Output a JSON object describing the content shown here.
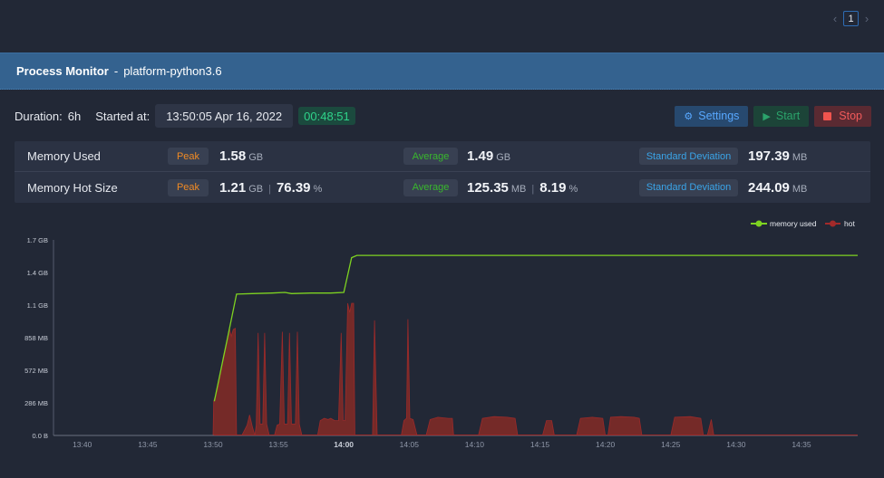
{
  "pagination": {
    "prev_icon": "chevron-left-icon",
    "current_page": "1",
    "next_icon": "chevron-right-icon"
  },
  "header": {
    "title": "Process Monitor",
    "separator": "-",
    "process": "platform-python3.6"
  },
  "toolbar": {
    "duration_label": "Duration:",
    "duration_value": "6h",
    "started_label": "Started at:",
    "started_value": "13:50:05 Apr 16, 2022",
    "elapsed": "00:48:51",
    "settings_label": "Settings",
    "start_label": "Start",
    "stop_label": "Stop"
  },
  "stats": {
    "rows": [
      {
        "name": "Memory Used",
        "peak_label": "Peak",
        "peak_value": "1.58",
        "peak_unit": "GB",
        "avg_label": "Average",
        "avg_value": "1.49",
        "avg_unit": "GB",
        "sd_label": "Standard Deviation",
        "sd_value": "197.39",
        "sd_unit": "MB"
      },
      {
        "name": "Memory Hot Size",
        "peak_label": "Peak",
        "peak_value": "1.21",
        "peak_unit": "GB",
        "peak_pct": "76.39",
        "pct_unit": "%",
        "avg_label": "Average",
        "avg_value": "125.35",
        "avg_unit": "MB",
        "avg_pct": "8.19",
        "sd_label": "Standard Deviation",
        "sd_value": "244.09",
        "sd_unit": "MB"
      }
    ]
  },
  "colors": {
    "memory_used": "#7ed321",
    "hot": "#8b2525",
    "hot_fill": "#7a2a28",
    "accent": "#34628f"
  },
  "chart_data": {
    "type": "area",
    "title": "",
    "xlabel": "",
    "ylabel": "",
    "x_unit": "minutes since 13:37",
    "x_ticks": [
      "13:40",
      "13:45",
      "13:50",
      "13:55",
      "14:00",
      "14:05",
      "14:10",
      "14:15",
      "14:20",
      "14:25",
      "14:30",
      "14:35"
    ],
    "x_tick_values": [
      3,
      8,
      13,
      18,
      23,
      28,
      33,
      38,
      43,
      48,
      53,
      58
    ],
    "bold_tick": "14:00",
    "xlim": [
      0.8,
      62.3
    ],
    "y_ticks": [
      "0.0 B",
      "286 MB",
      "572 MB",
      "858 MB",
      "1.1 GB",
      "1.4 GB",
      "1.7 GB"
    ],
    "y_tick_values_mb": [
      0,
      286,
      572,
      858,
      1144,
      1430,
      1716
    ],
    "ylim_mb": [
      0,
      1716
    ],
    "legend": [
      {
        "name": "memory used",
        "color": "#7ed321"
      },
      {
        "name": "hot",
        "color": "#a32a2a"
      }
    ],
    "legend_position": "top-right",
    "grid": false,
    "series": [
      {
        "name": "memory used",
        "type": "line",
        "points": [
          [
            13.1,
            300
          ],
          [
            14.1,
            850
          ],
          [
            14.8,
            1240
          ],
          [
            16.0,
            1245
          ],
          [
            17.5,
            1250
          ],
          [
            18.5,
            1255
          ],
          [
            19.0,
            1245
          ],
          [
            20.5,
            1250
          ],
          [
            22.0,
            1250
          ],
          [
            23.0,
            1255
          ],
          [
            23.6,
            1560
          ],
          [
            24.0,
            1580
          ],
          [
            26.0,
            1580
          ],
          [
            30.0,
            1580
          ],
          [
            40.0,
            1580
          ],
          [
            50.0,
            1580
          ],
          [
            62.3,
            1580
          ]
        ]
      },
      {
        "name": "hot",
        "type": "area",
        "points": [
          [
            13.0,
            0
          ],
          [
            13.05,
            300
          ],
          [
            13.4,
            420
          ],
          [
            13.8,
            700
          ],
          [
            14.1,
            850
          ],
          [
            14.25,
            940
          ],
          [
            14.4,
            870
          ],
          [
            14.55,
            930
          ],
          [
            14.7,
            940
          ],
          [
            14.8,
            0
          ],
          [
            15.2,
            0
          ],
          [
            15.6,
            90
          ],
          [
            15.8,
            180
          ],
          [
            16.0,
            80
          ],
          [
            16.2,
            0
          ],
          [
            16.3,
            90
          ],
          [
            16.45,
            900
          ],
          [
            16.6,
            100
          ],
          [
            16.8,
            100
          ],
          [
            16.95,
            900
          ],
          [
            17.1,
            100
          ],
          [
            17.3,
            0
          ],
          [
            17.5,
            0
          ],
          [
            17.7,
            0
          ],
          [
            17.9,
            90
          ],
          [
            18.1,
            100
          ],
          [
            18.3,
            910
          ],
          [
            18.45,
            100
          ],
          [
            18.7,
            100
          ],
          [
            18.85,
            900
          ],
          [
            19.0,
            100
          ],
          [
            19.3,
            100
          ],
          [
            19.45,
            910
          ],
          [
            19.6,
            100
          ],
          [
            19.8,
            0
          ],
          [
            21.0,
            0
          ],
          [
            21.2,
            130
          ],
          [
            21.5,
            150
          ],
          [
            21.8,
            140
          ],
          [
            22.0,
            150
          ],
          [
            22.3,
            130
          ],
          [
            22.6,
            130
          ],
          [
            22.8,
            900
          ],
          [
            22.95,
            130
          ],
          [
            23.1,
            130
          ],
          [
            23.3,
            1160
          ],
          [
            23.45,
            1080
          ],
          [
            23.6,
            1160
          ],
          [
            23.75,
            1160
          ],
          [
            23.85,
            0
          ],
          [
            25.2,
            0
          ],
          [
            25.35,
            1010
          ],
          [
            25.55,
            0
          ],
          [
            27.4,
            0
          ],
          [
            27.6,
            130
          ],
          [
            27.8,
            150
          ],
          [
            27.9,
            1020
          ],
          [
            28.05,
            150
          ],
          [
            28.3,
            140
          ],
          [
            28.6,
            0
          ],
          [
            29.3,
            0
          ],
          [
            29.6,
            140
          ],
          [
            30.2,
            160
          ],
          [
            31.0,
            150
          ],
          [
            31.3,
            150
          ],
          [
            31.4,
            0
          ],
          [
            33.3,
            0
          ],
          [
            33.6,
            150
          ],
          [
            34.5,
            165
          ],
          [
            35.5,
            160
          ],
          [
            36.1,
            150
          ],
          [
            36.3,
            0
          ],
          [
            38.2,
            0
          ],
          [
            38.5,
            130
          ],
          [
            38.9,
            130
          ],
          [
            39.1,
            0
          ],
          [
            40.8,
            0
          ],
          [
            41.1,
            150
          ],
          [
            42.0,
            160
          ],
          [
            42.8,
            150
          ],
          [
            43.0,
            0
          ],
          [
            43.2,
            0
          ],
          [
            43.4,
            160
          ],
          [
            44.2,
            165
          ],
          [
            45.2,
            160
          ],
          [
            45.6,
            150
          ],
          [
            45.8,
            0
          ],
          [
            48.0,
            0
          ],
          [
            48.3,
            160
          ],
          [
            49.5,
            165
          ],
          [
            50.3,
            150
          ],
          [
            50.5,
            0
          ],
          [
            50.8,
            0
          ],
          [
            51.1,
            140
          ],
          [
            51.3,
            0
          ],
          [
            51.6,
            0
          ]
        ]
      }
    ]
  }
}
